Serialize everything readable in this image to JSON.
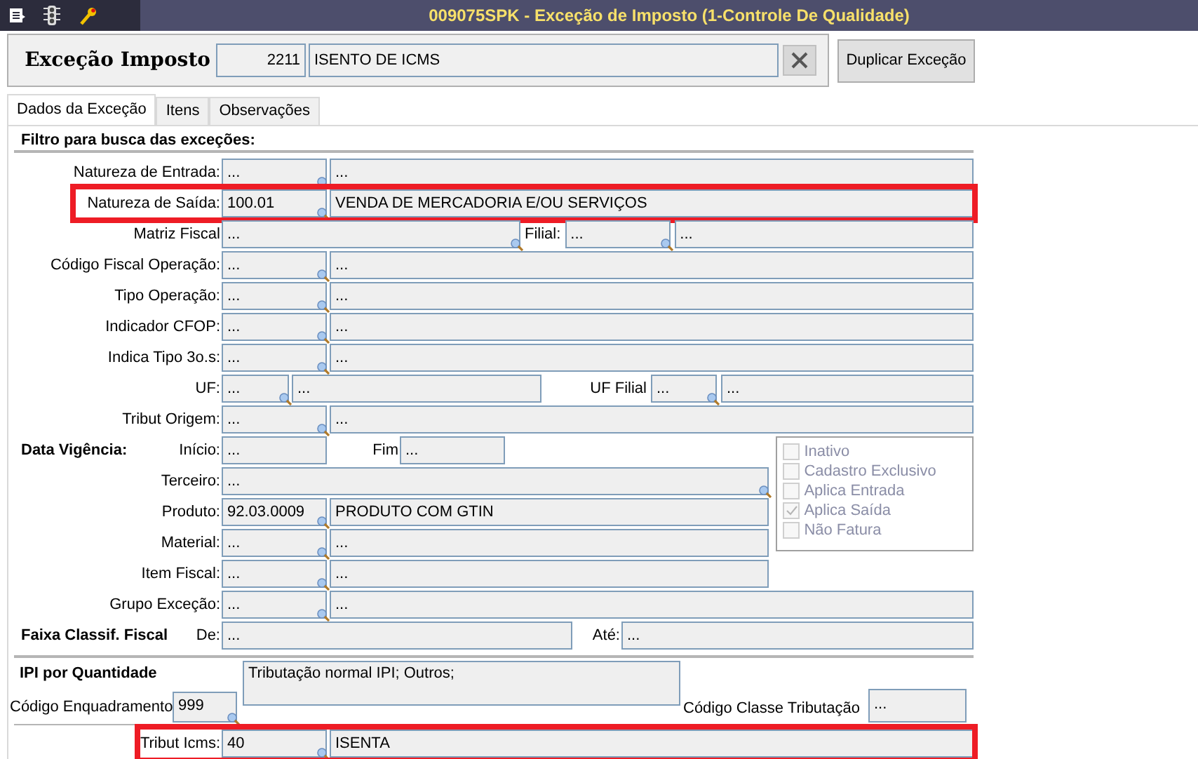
{
  "window": {
    "title": "009075SPK - Exceção de Imposto (1-Controle De Qualidade)"
  },
  "header": {
    "label": "Exceção Imposto",
    "code": "2211",
    "description": "ISENTO DE ICMS",
    "button": "Duplicar Exceção"
  },
  "tabs": [
    {
      "label": "Dados da Exceção",
      "selected": true
    },
    {
      "label": "Itens",
      "selected": false
    },
    {
      "label": "Observações",
      "selected": false
    }
  ],
  "filter": {
    "title": "Filtro para busca das exceções:",
    "rows": [
      {
        "kind": "lookup",
        "label": "Natureza de Entrada:",
        "code": "...",
        "description": "...",
        "highlighted": false
      },
      {
        "kind": "lookup",
        "label": "Natureza de Saída:",
        "code": "100.01",
        "description": "VENDA DE MERCADORIA E/OU SERVIÇOS",
        "highlighted": true
      },
      {
        "kind": "split",
        "label": "Matriz Fiscal",
        "code": "...",
        "label_2": "Filial:",
        "code_2": "...",
        "description_2": "..."
      },
      {
        "kind": "lookup",
        "label": "Código Fiscal Operação:",
        "code": "...",
        "description": "...",
        "highlighted": false
      },
      {
        "kind": "lookup",
        "label": "Tipo Operação:",
        "code": "...",
        "description": "...",
        "highlighted": false
      },
      {
        "kind": "lookup",
        "label": "Indicador CFOP:",
        "code": "...",
        "description": "...",
        "highlighted": false
      },
      {
        "kind": "lookup",
        "label": "Indica Tipo 3o.s:",
        "code": "...",
        "description": "...",
        "highlighted": false
      },
      {
        "kind": "uf",
        "label": "UF:",
        "code": "...",
        "description": "...",
        "label_2": "UF Filial",
        "code_2": "...",
        "description_2": "..."
      },
      {
        "kind": "lookup",
        "label": "Tribut Origem:",
        "code": "...",
        "description": "...",
        "highlighted": false
      }
    ]
  },
  "validity": {
    "section": "Data Vigência:",
    "start_label": "Início:",
    "start": "...",
    "end_label": "Fim",
    "end": "..."
  },
  "middle_rows": [
    {
      "kind": "single",
      "label": "Terceiro:",
      "code": "..."
    },
    {
      "kind": "lookup",
      "label": "Produto:",
      "code": "92.03.0009",
      "description": "PRODUTO COM GTIN",
      "highlighted": false
    },
    {
      "kind": "lookup",
      "label": "Material:",
      "code": "...",
      "description": "...",
      "highlighted": false
    },
    {
      "kind": "lookup",
      "label": "Item Fiscal:",
      "code": "...",
      "description": "...",
      "highlighted": false
    }
  ],
  "flags": [
    {
      "label": "Inativo",
      "checked": false,
      "disabled": true
    },
    {
      "label": "Cadastro Exclusivo",
      "checked": false,
      "disabled": true
    },
    {
      "label": "Aplica Entrada",
      "checked": false,
      "disabled": true
    },
    {
      "label": "Aplica Saída",
      "checked": true,
      "disabled": true
    },
    {
      "label": "Não Fatura",
      "checked": false,
      "disabled": true
    }
  ],
  "group_row": {
    "kind": "lookup",
    "label": "Grupo Exceção:",
    "code": "...",
    "description": "...",
    "highlighted": false
  },
  "classification": {
    "section": "Faixa Classif. Fiscal",
    "from_label": "De:",
    "from": "...",
    "to_label": "Até:",
    "to": "..."
  },
  "ipi": {
    "title": "IPI por Quantidade",
    "description": "Tributação normal IPI; Outros;",
    "code_label": "Código Enquadramento",
    "code": "999",
    "class_label": "Código Classe Tributação",
    "class_code": "..."
  },
  "icms_row": {
    "kind": "lookup",
    "label": "Tribut Icms:",
    "code": "40",
    "description": "ISENTA",
    "highlighted": true
  }
}
